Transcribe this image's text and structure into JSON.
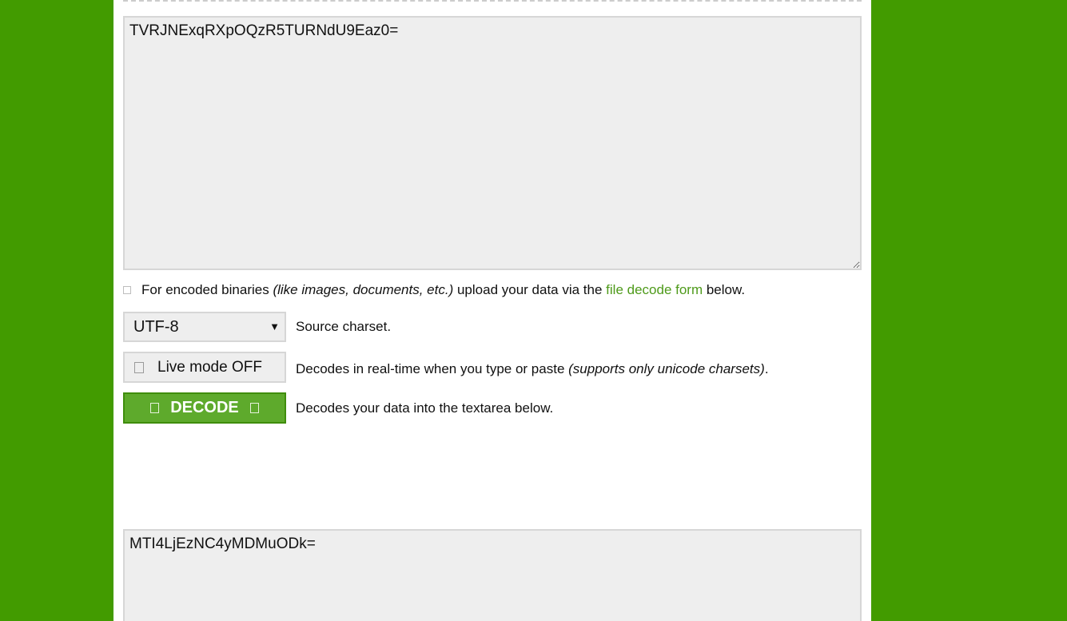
{
  "input": {
    "value": "TVRJNExqRXpOQzR5TURNdU9Eaz0="
  },
  "binaries_note": {
    "prefix": "For encoded binaries ",
    "italic": "(like images, documents, etc.)",
    "middle": " upload your data via the ",
    "link": "file decode form",
    "suffix": " below."
  },
  "charset": {
    "selected": "UTF-8",
    "arrow": "▼",
    "description": "Source charset."
  },
  "live_mode": {
    "label": "Live mode OFF",
    "description_prefix": "Decodes in real-time when you type or paste ",
    "description_italic": "(supports only unicode charsets)",
    "description_suffix": "."
  },
  "decode": {
    "label": "DECODE",
    "description": "Decodes your data into the textarea below."
  },
  "output": {
    "value": "MTI4LjEzNC4yMDMuODk="
  },
  "colors": {
    "background_green": "#429b00",
    "button_green": "#5eaa2c",
    "link_green": "#4e9a1a",
    "field_gray": "#eeeeee"
  },
  "icons": {
    "live_mode_icon": "checkbox-square-icon",
    "decode_left_icon": "square-glyph-icon",
    "decode_right_icon": "square-glyph-icon"
  }
}
